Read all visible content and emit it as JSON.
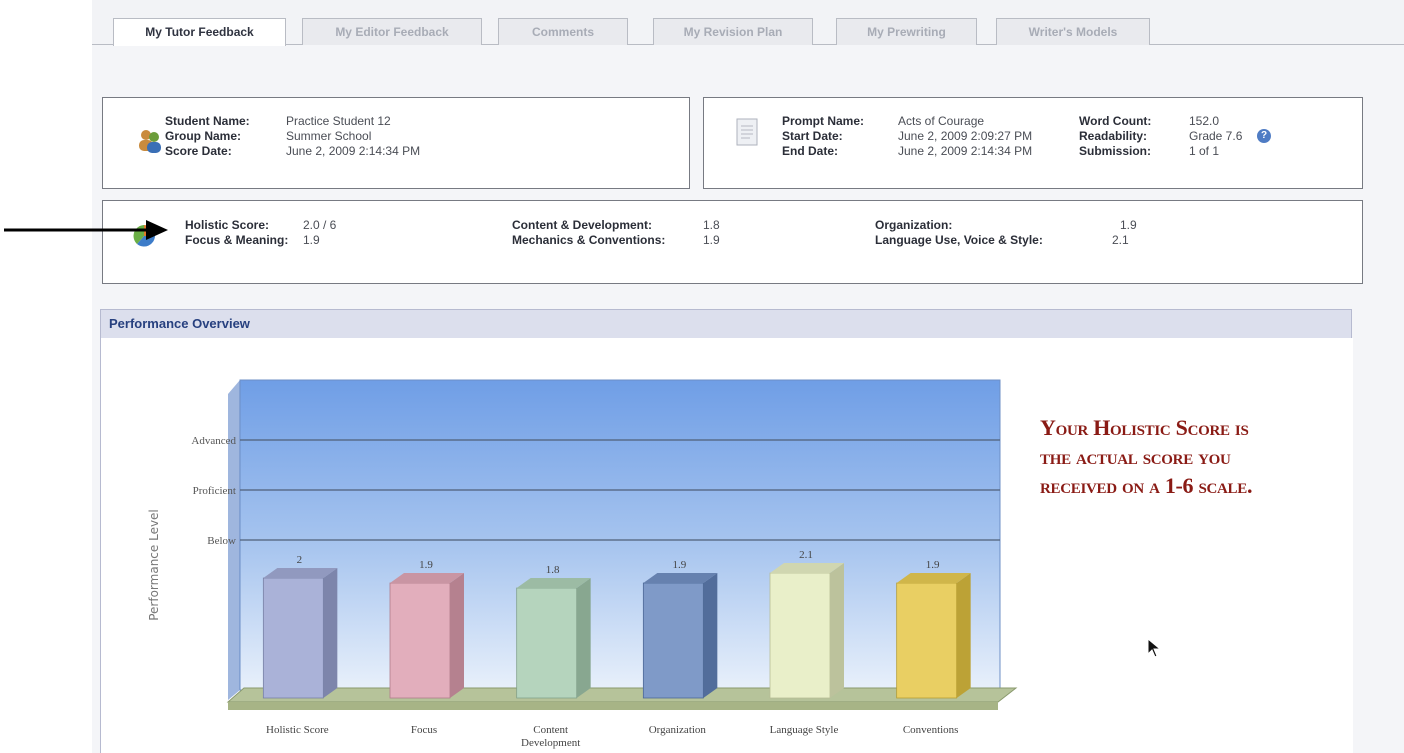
{
  "tabs": [
    {
      "label": "My Tutor Feedback",
      "active": true
    },
    {
      "label": "My Editor Feedback",
      "active": false
    },
    {
      "label": "Comments",
      "active": false
    },
    {
      "label": "My Revision Plan",
      "active": false
    },
    {
      "label": "My Prewriting",
      "active": false
    },
    {
      "label": "Writer's Models",
      "active": false
    }
  ],
  "student": {
    "name_label": "Student Name:",
    "name_value": "Practice Student 12",
    "group_label": "Group Name:",
    "group_value": "Summer School",
    "score_date_label": "Score Date:",
    "score_date_value": "June 2, 2009 2:14:34 PM",
    "icon": "users-icon"
  },
  "prompt": {
    "name_label": "Prompt Name:",
    "name_value": "Acts of Courage",
    "start_label": "Start Date:",
    "start_value": "June 2, 2009 2:09:27 PM",
    "end_label": "End Date:",
    "end_value": "June 2, 2009 2:14:34 PM",
    "word_count_label": "Word Count:",
    "word_count_value": "152.0",
    "readability_label": "Readability:",
    "readability_value": "Grade 7.6",
    "submission_label": "Submission:",
    "submission_value": "1 of 1",
    "icon": "document-icon",
    "help_icon": "help-icon",
    "help_glyph": "?"
  },
  "scores": {
    "holistic_label": "Holistic Score:",
    "holistic_value": "2.0 / 6",
    "focus_label": "Focus & Meaning:",
    "focus_value": "1.9",
    "content_label": "Content & Development:",
    "content_value": "1.8",
    "mechanics_label": "Mechanics & Conventions:",
    "mechanics_value": "1.9",
    "organization_label": "Organization:",
    "organization_value": "1.9",
    "language_label": "Language Use, Voice & Style:",
    "language_value": "2.1",
    "icon": "chart-icon"
  },
  "performance": {
    "title": "Performance Overview"
  },
  "annotation": {
    "line1": "Your Holistic Score is",
    "line2": "the actual score you",
    "line3": "received on a 1-6 scale."
  },
  "colors": {
    "header_blue": "#27407f",
    "annotation_red": "#8a1b15",
    "help_blue": "#4f7cc4"
  },
  "chart_data": {
    "type": "bar",
    "ylabel": "Performance Level",
    "xlabel": "",
    "levels": [
      "Advanced",
      "Proficient",
      "Below"
    ],
    "categories": [
      "Holistic Score",
      "Focus",
      "Content Development",
      "Organization",
      "Language Style",
      "Conventions"
    ],
    "values": [
      2,
      1.9,
      1.8,
      1.9,
      2.1,
      1.9
    ],
    "value_labels": [
      "2",
      "1.9",
      "1.8",
      "1.9",
      "2.1",
      "1.9"
    ],
    "colors": [
      "#aab2d8",
      "#e2aebc",
      "#b5d4bd",
      "#7f9ac8",
      "#e9efc9",
      "#e9cf63"
    ],
    "grid": true
  }
}
